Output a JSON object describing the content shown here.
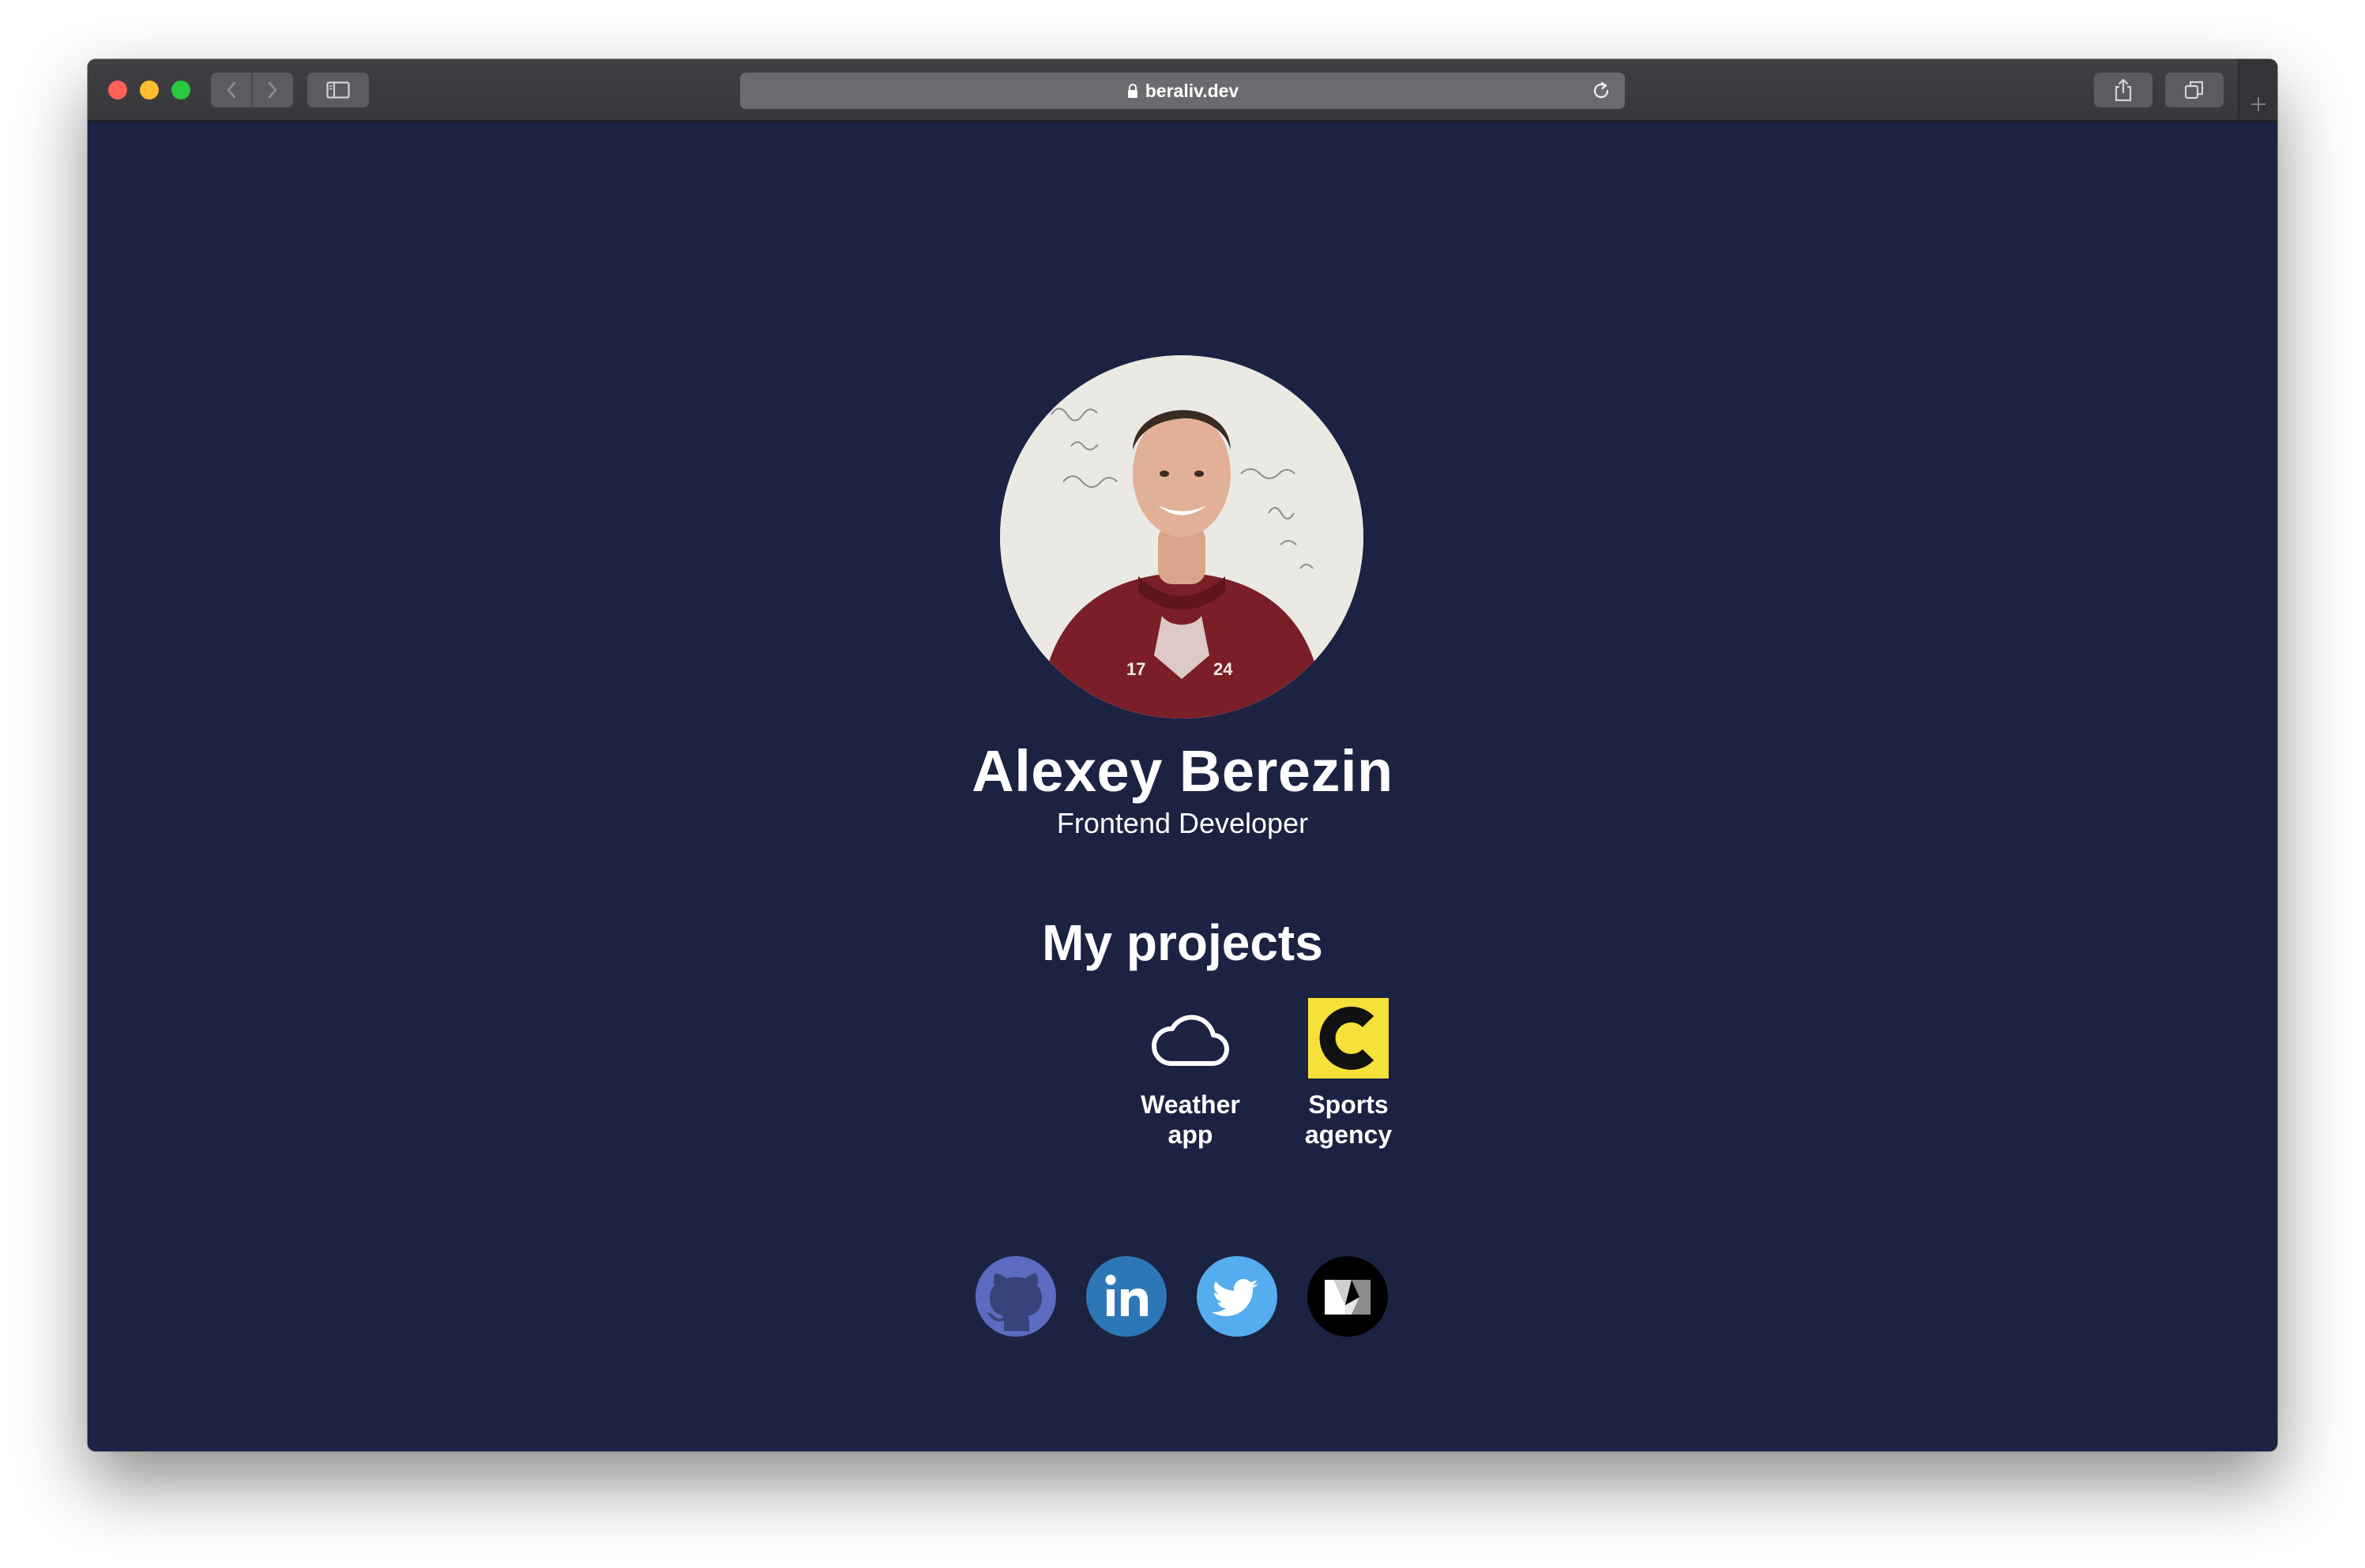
{
  "browser": {
    "url": "beraliv.dev",
    "icons": {
      "back": "chevron-left-icon",
      "forward": "chevron-right-icon",
      "sidebar": "sidebar-icon",
      "lock": "lock-icon",
      "reload": "reload-icon",
      "share": "share-icon",
      "tabs": "tabs-overview-icon",
      "new_tab": "plus-icon"
    }
  },
  "profile": {
    "name": "Alexey Berezin",
    "role": "Frontend Developer",
    "avatar": "profile-photo"
  },
  "projects": {
    "title": "My projects",
    "items": [
      {
        "label_line1": "Weather",
        "label_line2": "app",
        "icon": "cloud-icon"
      },
      {
        "label_line1": "Sports",
        "label_line2": "agency",
        "icon": "sports-agency-logo-icon",
        "color": "#f6e03a"
      }
    ]
  },
  "social": [
    {
      "name": "github",
      "icon": "github-icon",
      "color": "#5c6bc0"
    },
    {
      "name": "linkedin",
      "icon": "linkedin-icon",
      "color": "#2e77b6"
    },
    {
      "name": "twitter",
      "icon": "twitter-icon",
      "color": "#55acee"
    },
    {
      "name": "medium",
      "icon": "medium-icon",
      "color": "#000000"
    }
  ],
  "colors": {
    "page_background": "#1c2242",
    "text": "#ffffff"
  }
}
